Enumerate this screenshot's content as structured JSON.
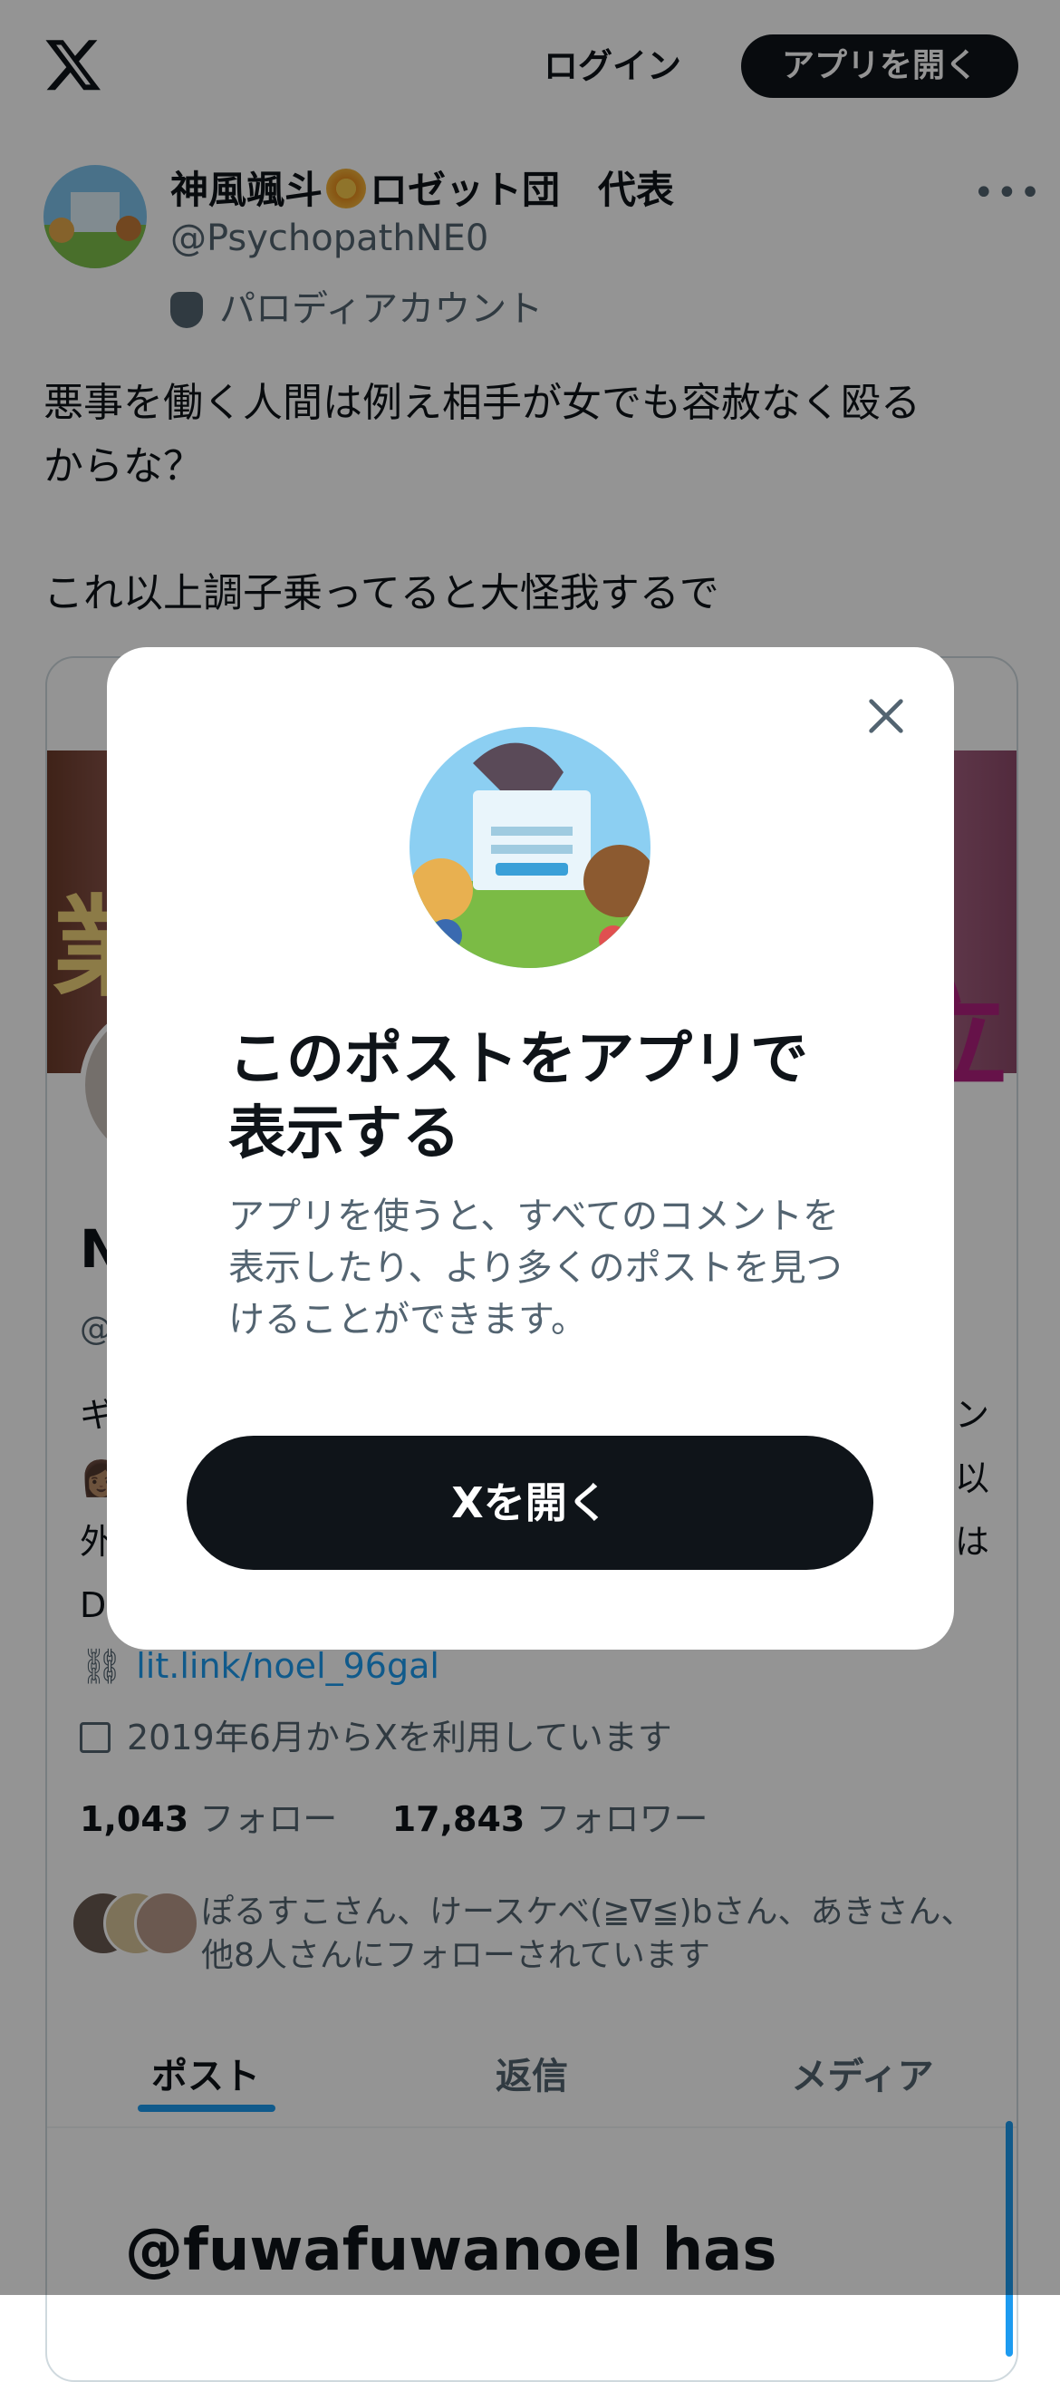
{
  "topbar": {
    "login_label": "ログイン",
    "open_app_label": "アプリを開く"
  },
  "post": {
    "author_name_part1": "神風颯斗",
    "author_name_part2": "ロゼット団　代表",
    "author_handle": "@PsychopathNE0",
    "parody_label": "パロディアカウント",
    "more_label": "•••",
    "text": "悪事を働く人間は例え相手が女でも容赦なく殴る\nからな？\n\nこれ以上調子乗ってると大怪我するで"
  },
  "card": {
    "name": "N",
    "handle": "@",
    "bio_lines": [
      "ギ",
      "👩🏽",
      "外",
      "D"
    ],
    "bio_lines_right": [
      "ン",
      "以",
      "は"
    ],
    "link": "lit.link/noel_96gal",
    "joined": "2019年6月からXを利用しています",
    "following_count": "1,043",
    "following_label": "フォロー",
    "followers_count": "17,843",
    "followers_label": "フォロワー",
    "followed_by": "ぽるすこさん、けースケベ(≧∇≦)bさん、あきさん、他8人さんにフォローされています",
    "tabs": [
      "ポスト",
      "返信",
      "メディア"
    ],
    "bottom_text": "@fuwafuwanoel has"
  },
  "modal": {
    "title": "このポストをアプリで表示する",
    "description": "アプリを使うと、すべてのコメントを表示したり、より多くのポストを見つけることができます。",
    "button_label": "Xを開く",
    "close_icon": "close-icon"
  },
  "colors": {
    "text": "#0f1419",
    "secondary": "#536471",
    "accent": "#1d9bf0",
    "button": "#0f1419"
  }
}
